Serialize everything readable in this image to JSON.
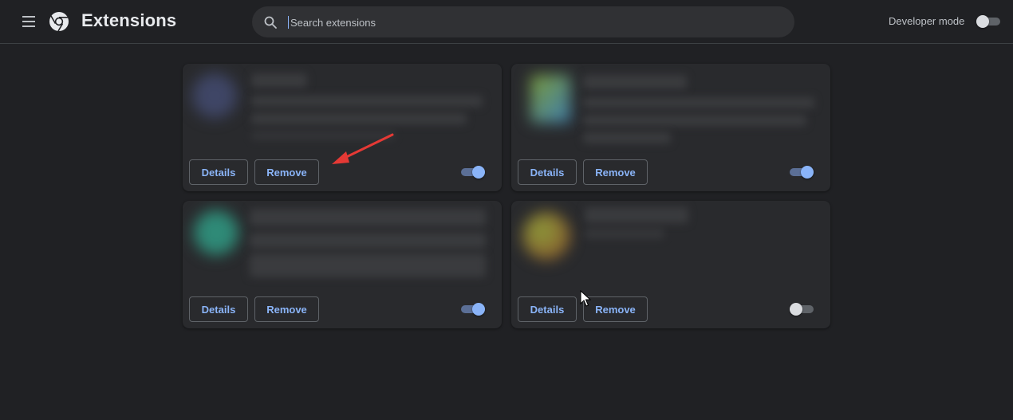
{
  "header": {
    "title": "Extensions",
    "search_placeholder": "Search extensions",
    "developer_mode_label": "Developer mode",
    "developer_mode_on": false
  },
  "icons": {
    "menu": "hamburger-menu-icon",
    "logo": "chrome-logo-icon",
    "search": "search-icon"
  },
  "extensions": [
    {
      "details_label": "Details",
      "remove_label": "Remove",
      "enabled": true
    },
    {
      "details_label": "Details",
      "remove_label": "Remove",
      "enabled": true
    },
    {
      "details_label": "Details",
      "remove_label": "Remove",
      "enabled": true
    },
    {
      "details_label": "Details",
      "remove_label": "Remove",
      "enabled": false
    }
  ],
  "colors": {
    "background": "#202124",
    "card": "#292a2d",
    "accent": "#8ab4f8",
    "annotation_arrow": "#e53935"
  }
}
